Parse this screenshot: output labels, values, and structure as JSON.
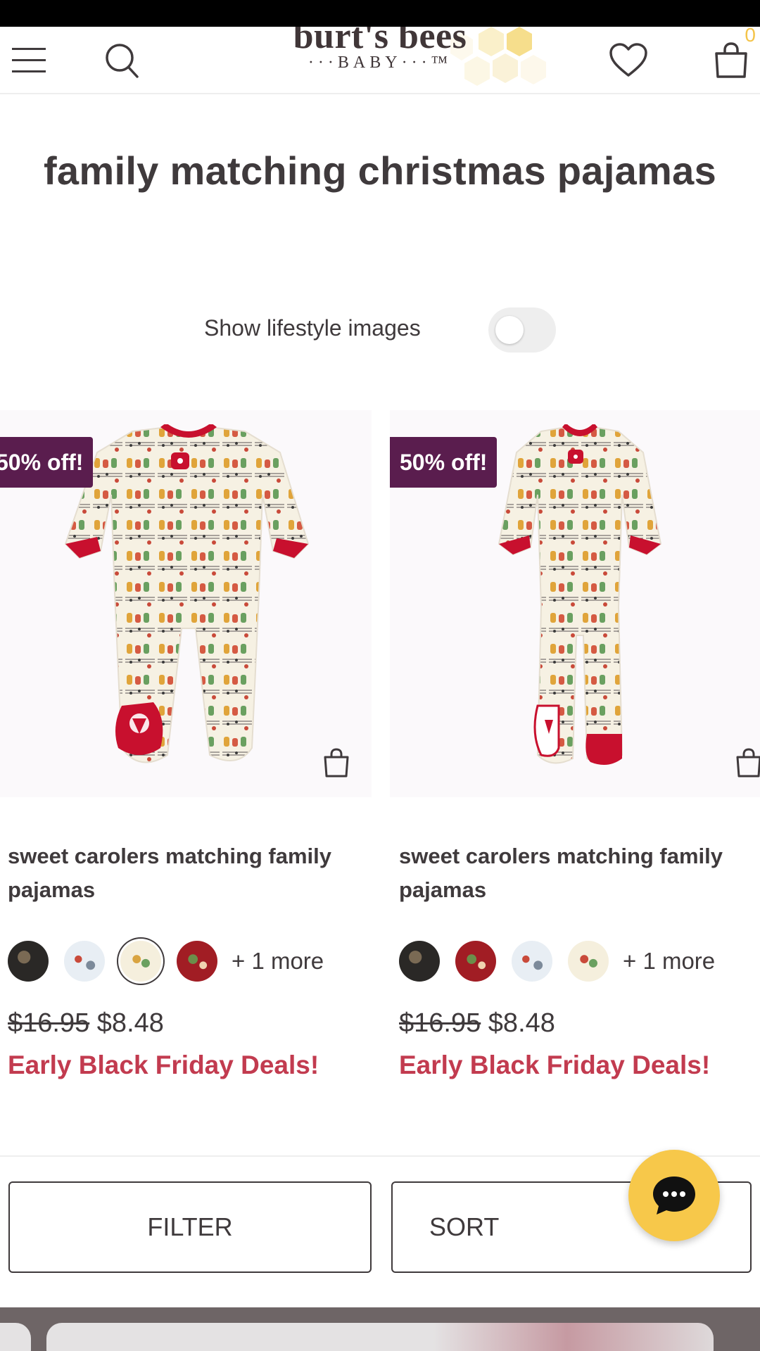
{
  "header": {
    "logo_main": "burt's bees",
    "logo_sub": "···BABY···™",
    "cart_count": "0",
    "icons": [
      "hamburger-menu-icon",
      "search-icon",
      "heart-icon",
      "shopping-bag-icon"
    ],
    "accent_color": "#f4c44a"
  },
  "page_title": "family matching christmas pajamas",
  "lifestyle_toggle": {
    "label": "Show lifestyle images",
    "on": false
  },
  "products": [
    {
      "badge": "50% off!",
      "name": "sweet carolers matching family pajamas",
      "swatches": [
        "dark-print",
        "light-blue-print",
        "cream-print",
        "red-print"
      ],
      "selected_swatch": 2,
      "more": "+ 1 more",
      "old_price": "$16.95",
      "price": "$8.48",
      "promo": "Early Black Friday Deals!"
    },
    {
      "badge": "50% off!",
      "name": "sweet carolers matching family pajamas",
      "swatches": [
        "dark-print",
        "red-print",
        "light-blue-print",
        "cream-print"
      ],
      "more": "+ 1 more",
      "old_price": "$16.95",
      "price": "$8.48",
      "promo": "Early Black Friday Deals!"
    }
  ],
  "actions": {
    "filter_label": "FILTER",
    "sort_label": "SORT"
  },
  "colors": {
    "badge_bg": "#5a1d4e",
    "promo": "#c23b4f",
    "chat_button": "#f7c84a"
  }
}
